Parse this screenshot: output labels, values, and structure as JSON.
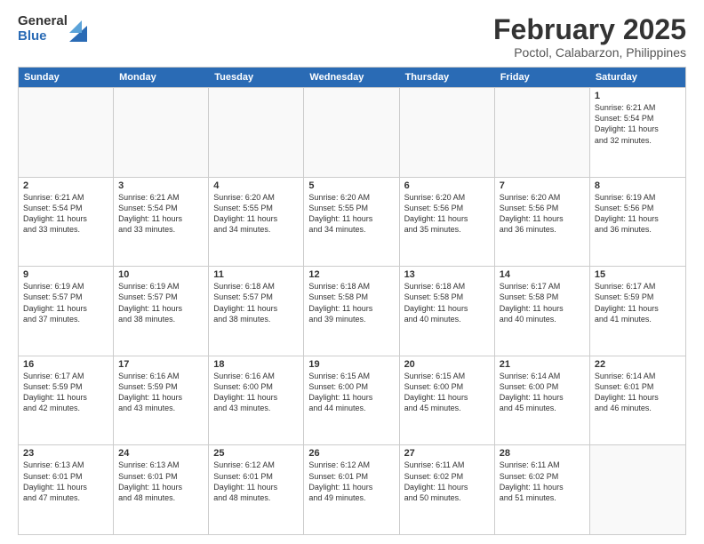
{
  "logo": {
    "general": "General",
    "blue": "Blue"
  },
  "header": {
    "month_year": "February 2025",
    "location": "Poctol, Calabarzon, Philippines"
  },
  "weekdays": [
    "Sunday",
    "Monday",
    "Tuesday",
    "Wednesday",
    "Thursday",
    "Friday",
    "Saturday"
  ],
  "weeks": [
    [
      {
        "day": "",
        "info": ""
      },
      {
        "day": "",
        "info": ""
      },
      {
        "day": "",
        "info": ""
      },
      {
        "day": "",
        "info": ""
      },
      {
        "day": "",
        "info": ""
      },
      {
        "day": "",
        "info": ""
      },
      {
        "day": "1",
        "info": "Sunrise: 6:21 AM\nSunset: 5:54 PM\nDaylight: 11 hours\nand 32 minutes."
      }
    ],
    [
      {
        "day": "2",
        "info": "Sunrise: 6:21 AM\nSunset: 5:54 PM\nDaylight: 11 hours\nand 33 minutes."
      },
      {
        "day": "3",
        "info": "Sunrise: 6:21 AM\nSunset: 5:54 PM\nDaylight: 11 hours\nand 33 minutes."
      },
      {
        "day": "4",
        "info": "Sunrise: 6:20 AM\nSunset: 5:55 PM\nDaylight: 11 hours\nand 34 minutes."
      },
      {
        "day": "5",
        "info": "Sunrise: 6:20 AM\nSunset: 5:55 PM\nDaylight: 11 hours\nand 34 minutes."
      },
      {
        "day": "6",
        "info": "Sunrise: 6:20 AM\nSunset: 5:56 PM\nDaylight: 11 hours\nand 35 minutes."
      },
      {
        "day": "7",
        "info": "Sunrise: 6:20 AM\nSunset: 5:56 PM\nDaylight: 11 hours\nand 36 minutes."
      },
      {
        "day": "8",
        "info": "Sunrise: 6:19 AM\nSunset: 5:56 PM\nDaylight: 11 hours\nand 36 minutes."
      }
    ],
    [
      {
        "day": "9",
        "info": "Sunrise: 6:19 AM\nSunset: 5:57 PM\nDaylight: 11 hours\nand 37 minutes."
      },
      {
        "day": "10",
        "info": "Sunrise: 6:19 AM\nSunset: 5:57 PM\nDaylight: 11 hours\nand 38 minutes."
      },
      {
        "day": "11",
        "info": "Sunrise: 6:18 AM\nSunset: 5:57 PM\nDaylight: 11 hours\nand 38 minutes."
      },
      {
        "day": "12",
        "info": "Sunrise: 6:18 AM\nSunset: 5:58 PM\nDaylight: 11 hours\nand 39 minutes."
      },
      {
        "day": "13",
        "info": "Sunrise: 6:18 AM\nSunset: 5:58 PM\nDaylight: 11 hours\nand 40 minutes."
      },
      {
        "day": "14",
        "info": "Sunrise: 6:17 AM\nSunset: 5:58 PM\nDaylight: 11 hours\nand 40 minutes."
      },
      {
        "day": "15",
        "info": "Sunrise: 6:17 AM\nSunset: 5:59 PM\nDaylight: 11 hours\nand 41 minutes."
      }
    ],
    [
      {
        "day": "16",
        "info": "Sunrise: 6:17 AM\nSunset: 5:59 PM\nDaylight: 11 hours\nand 42 minutes."
      },
      {
        "day": "17",
        "info": "Sunrise: 6:16 AM\nSunset: 5:59 PM\nDaylight: 11 hours\nand 43 minutes."
      },
      {
        "day": "18",
        "info": "Sunrise: 6:16 AM\nSunset: 6:00 PM\nDaylight: 11 hours\nand 43 minutes."
      },
      {
        "day": "19",
        "info": "Sunrise: 6:15 AM\nSunset: 6:00 PM\nDaylight: 11 hours\nand 44 minutes."
      },
      {
        "day": "20",
        "info": "Sunrise: 6:15 AM\nSunset: 6:00 PM\nDaylight: 11 hours\nand 45 minutes."
      },
      {
        "day": "21",
        "info": "Sunrise: 6:14 AM\nSunset: 6:00 PM\nDaylight: 11 hours\nand 45 minutes."
      },
      {
        "day": "22",
        "info": "Sunrise: 6:14 AM\nSunset: 6:01 PM\nDaylight: 11 hours\nand 46 minutes."
      }
    ],
    [
      {
        "day": "23",
        "info": "Sunrise: 6:13 AM\nSunset: 6:01 PM\nDaylight: 11 hours\nand 47 minutes."
      },
      {
        "day": "24",
        "info": "Sunrise: 6:13 AM\nSunset: 6:01 PM\nDaylight: 11 hours\nand 48 minutes."
      },
      {
        "day": "25",
        "info": "Sunrise: 6:12 AM\nSunset: 6:01 PM\nDaylight: 11 hours\nand 48 minutes."
      },
      {
        "day": "26",
        "info": "Sunrise: 6:12 AM\nSunset: 6:01 PM\nDaylight: 11 hours\nand 49 minutes."
      },
      {
        "day": "27",
        "info": "Sunrise: 6:11 AM\nSunset: 6:02 PM\nDaylight: 11 hours\nand 50 minutes."
      },
      {
        "day": "28",
        "info": "Sunrise: 6:11 AM\nSunset: 6:02 PM\nDaylight: 11 hours\nand 51 minutes."
      },
      {
        "day": "",
        "info": ""
      }
    ]
  ]
}
